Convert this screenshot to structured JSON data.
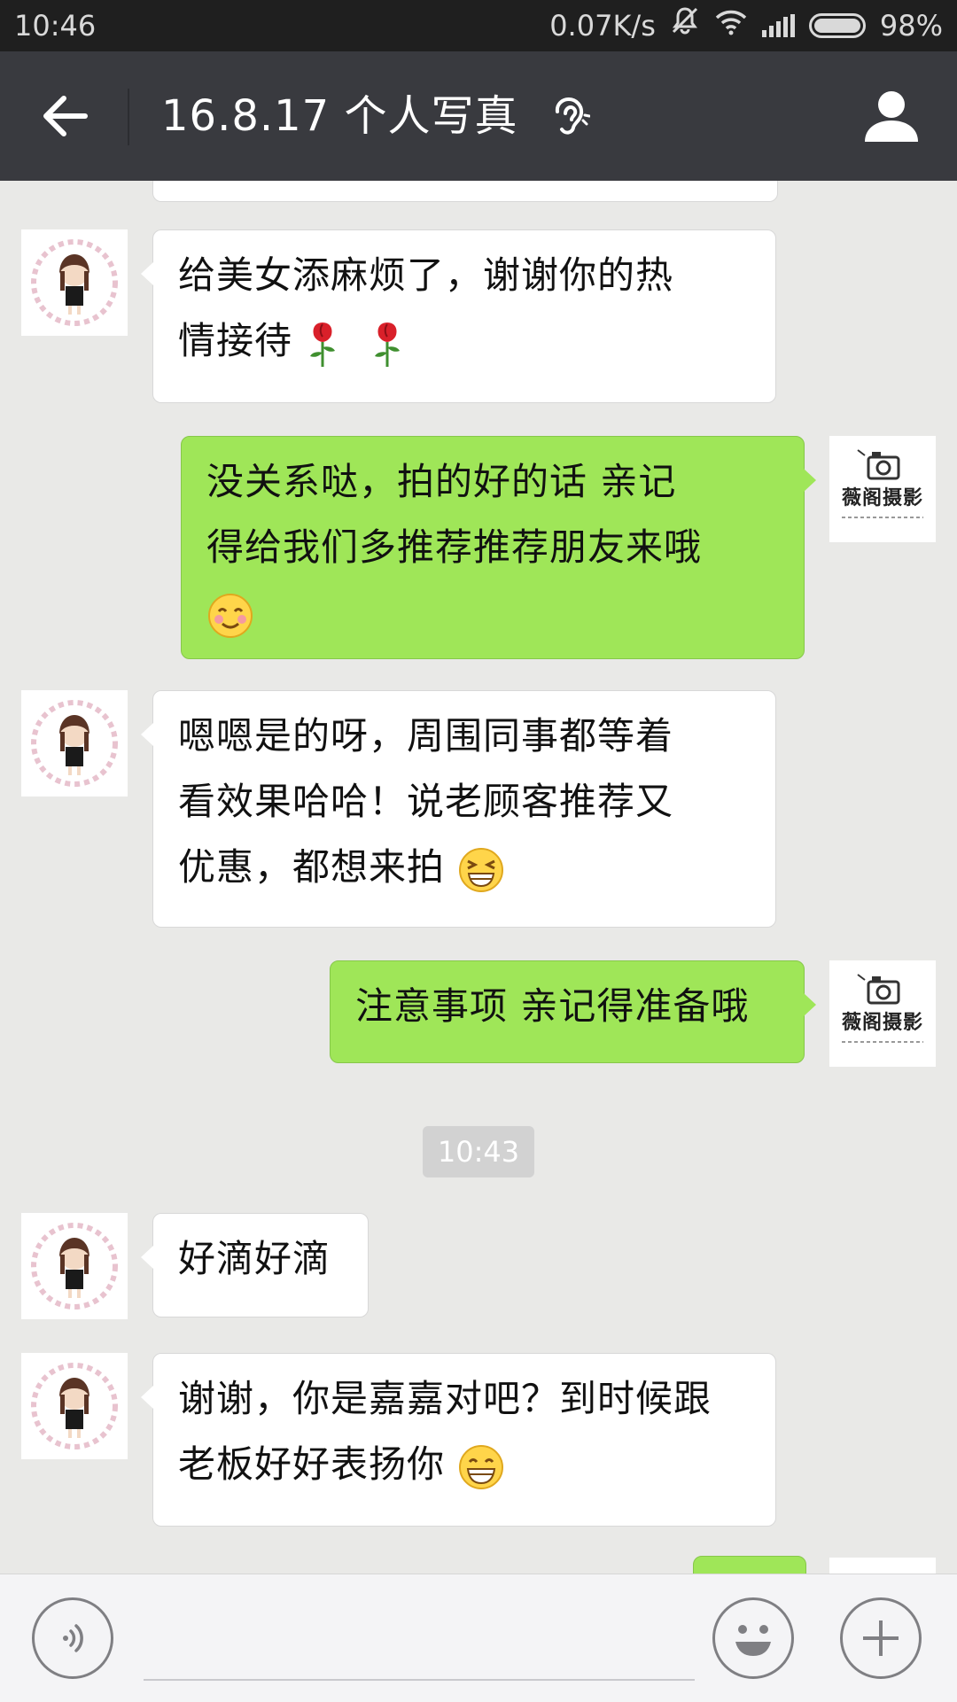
{
  "status_bar": {
    "time": "10:46",
    "network_speed": "0.07K/s",
    "battery": "98%",
    "icons": [
      "mute-icon",
      "wifi-icon",
      "signal-icon",
      "battery-icon"
    ]
  },
  "header": {
    "title": "16.8.17 个人写真",
    "back_icon": "back-arrow-icon",
    "earpiece_icon": "earpiece-mode-icon",
    "profile_icon": "person-icon"
  },
  "messages": [
    {
      "side": "in",
      "text_lines": [
        "给美女添麻烦了，谢谢你的热",
        "情接待"
      ],
      "emoji": [
        "rose-icon",
        "rose-icon"
      ]
    },
    {
      "side": "out",
      "text_lines": [
        "没关系哒，拍的好的话   亲记",
        "得给我们多推荐推荐朋友来哦"
      ],
      "emoji": [
        "smile-blush-icon"
      ]
    },
    {
      "side": "in",
      "text_lines": [
        "嗯嗯是的呀，周围同事都等着",
        "看效果哈哈！说老顾客推荐又",
        "优惠，都想来拍"
      ],
      "emoji": [
        "grin-squint-icon"
      ]
    },
    {
      "side": "out",
      "text_lines": [
        "注意事项 亲记得准备哦"
      ],
      "emoji": []
    },
    {
      "side": "in",
      "text_lines": [
        "好滴好滴"
      ],
      "emoji": []
    },
    {
      "side": "in",
      "text_lines": [
        "谢谢，你是嘉嘉对吧？到时候跟",
        "老板好好表扬你"
      ],
      "emoji": [
        "big-grin-icon"
      ]
    }
  ],
  "timestamp": "10:43",
  "studio_logo_text": "薇阁摄影",
  "colors": {
    "status_bar": "#1f1f1f",
    "title_bar": "#393a3f",
    "chat_bg": "#e9e9e7",
    "bubble_out": "#9fe658",
    "bubble_in": "#ffffff",
    "input_bar": "#f4f4f6"
  },
  "input": {
    "voice_icon": "voice-icon",
    "emoji_icon": "emoji-icon",
    "plus_icon": "plus-icon",
    "value": ""
  }
}
